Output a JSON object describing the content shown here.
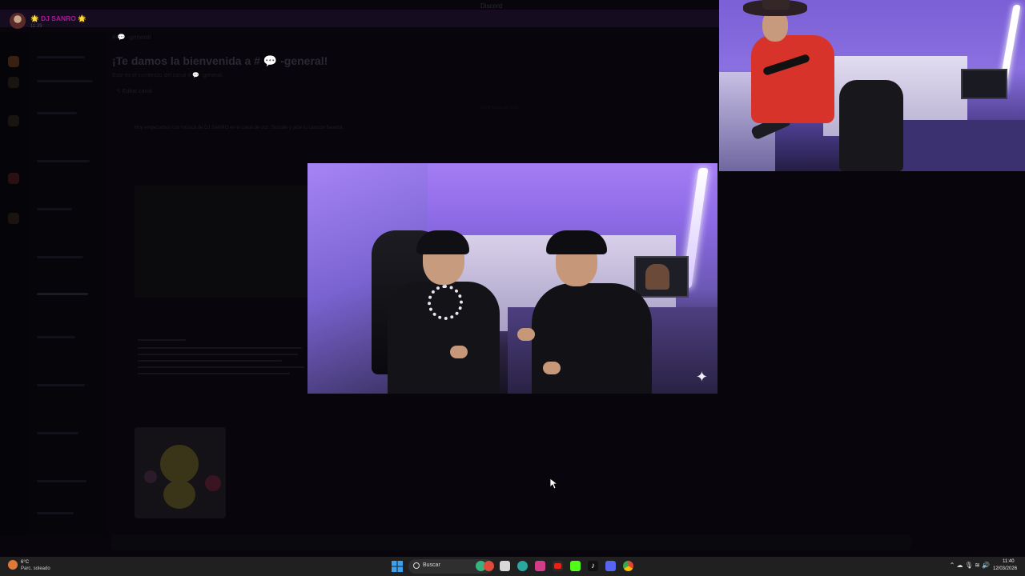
{
  "app": {
    "title": "Discord"
  },
  "stream_user": {
    "name": "🌟 DJ SANRO 🌟",
    "time": "11:39"
  },
  "channel": {
    "header": "# 💬 -general",
    "welcome_title": "¡Te damos la bienvenida a # 💬 -general!",
    "welcome_sub": "Este es el comienzo del canal # 💬 -general.",
    "edit_label": "✎ Editar canal",
    "message": "Hoy empezamos con música de DJ SANRO en el canal de voz. Súmate y pide tu canción favorita.",
    "date_divider": "12 de marzo de 2026"
  },
  "video": {
    "overlay_icon": "sparkle-icon"
  },
  "taskbar": {
    "weather_temp": "6°C",
    "weather_desc": "Parc. soleado",
    "search_label": "Buscar",
    "clock_time": "11:40",
    "clock_date": "12/03/2026",
    "systray": "⌃  ☁  🎙  ≋  🔊",
    "apps": [
      "start-icon",
      "widgets-icon",
      "vpn-icon",
      "file-explorer-icon",
      "edge-icon",
      "instagram-icon",
      "youtube-icon",
      "kick-icon",
      "tiktok-icon",
      "discord-icon",
      "chrome-icon"
    ]
  }
}
